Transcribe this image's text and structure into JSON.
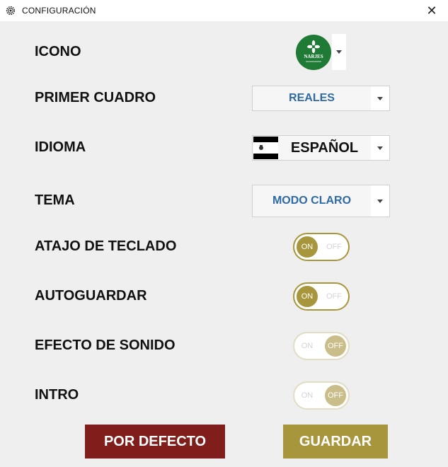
{
  "window": {
    "title": "CONFIGURACIÓN",
    "close_glyph": "✕"
  },
  "logo": {
    "text": "NARJES",
    "icon": "narjes-logo-icon",
    "color": "#1e7a35"
  },
  "settings": {
    "icon_label": "ICONO",
    "first_table_label": "PRIMER CUADRO",
    "first_table_value": "REALES",
    "language_label": "IDIOMA",
    "language_value": "ESPAÑOL",
    "theme_label": "TEMA",
    "theme_value": "MODO CLARO",
    "shortcut_label": "ATAJO DE TECLADO",
    "autosave_label": "AUTOGUARDAR",
    "sound_label": "EFECTO DE SONIDO",
    "intro_label": "INTRO"
  },
  "toggles": {
    "shortcut": {
      "state": "on",
      "on_text": "ON",
      "off_text": "OFF"
    },
    "autosave": {
      "state": "on",
      "on_text": "ON",
      "off_text": "OFF"
    },
    "sound": {
      "state": "off",
      "on_text": "ON",
      "off_text": "OFF"
    },
    "intro": {
      "state": "off",
      "on_text": "ON",
      "off_text": "OFF"
    }
  },
  "buttons": {
    "default_label": "POR DEFECTO",
    "save_label": "GUARDAR"
  },
  "colors": {
    "accent_gold": "#a8963c",
    "danger_red": "#7f1e1a",
    "select_text": "#2f6aa3"
  }
}
